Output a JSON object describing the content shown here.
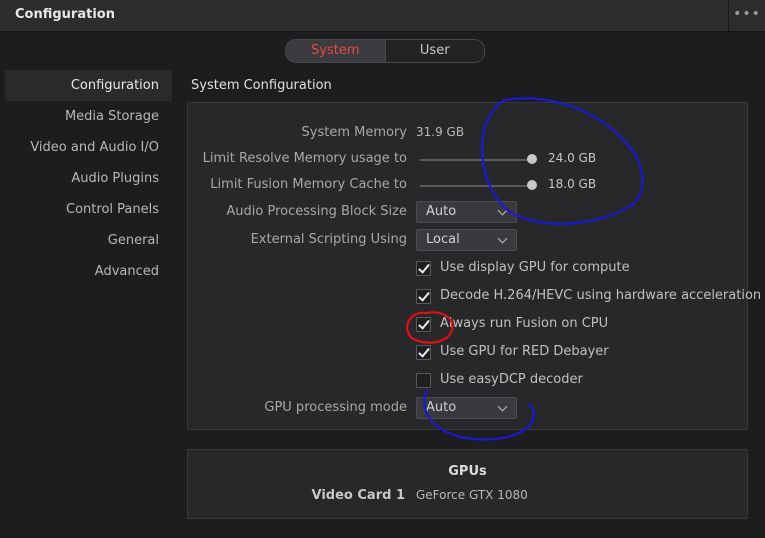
{
  "window": {
    "title": "Configuration",
    "menu_glyph": "•••"
  },
  "tabs": [
    {
      "label": "System",
      "active": true
    },
    {
      "label": "User",
      "active": false
    }
  ],
  "sidebar": {
    "items": [
      {
        "label": "Configuration",
        "active": true
      },
      {
        "label": "Media Storage"
      },
      {
        "label": "Video and Audio I/O"
      },
      {
        "label": "Audio Plugins"
      },
      {
        "label": "Control Panels"
      },
      {
        "label": "General"
      },
      {
        "label": "Advanced"
      }
    ]
  },
  "system_config": {
    "section_title": "System Configuration",
    "system_memory": {
      "label": "System Memory",
      "value": "31.9 GB"
    },
    "limit_resolve": {
      "label": "Limit Resolve Memory usage to",
      "value": "24.0 GB"
    },
    "limit_fusion": {
      "label": "Limit Fusion Memory Cache to",
      "value": "18.0 GB"
    },
    "audio_block": {
      "label": "Audio Processing Block Size",
      "value": "Auto"
    },
    "scripting": {
      "label": "External Scripting Using",
      "value": "Local"
    },
    "checkboxes": [
      {
        "label": "Use display GPU for compute",
        "checked": true
      },
      {
        "label": "Decode H.264/HEVC using hardware acceleration",
        "checked": true
      },
      {
        "label": "Always run Fusion on CPU",
        "checked": true
      },
      {
        "label": "Use GPU for RED Debayer",
        "checked": true
      },
      {
        "label": "Use easyDCP decoder",
        "checked": false
      }
    ],
    "gpu_mode": {
      "label": "GPU processing mode",
      "value": "Auto"
    }
  },
  "gpus": {
    "title": "GPUs",
    "video_card_label": "Video Card 1",
    "video_card_value": "GeForce GTX 1080"
  },
  "colors": {
    "accent_active_tab": "#e64b3c",
    "annotation_blue": "#1a1ad0",
    "annotation_red": "#e01010"
  }
}
